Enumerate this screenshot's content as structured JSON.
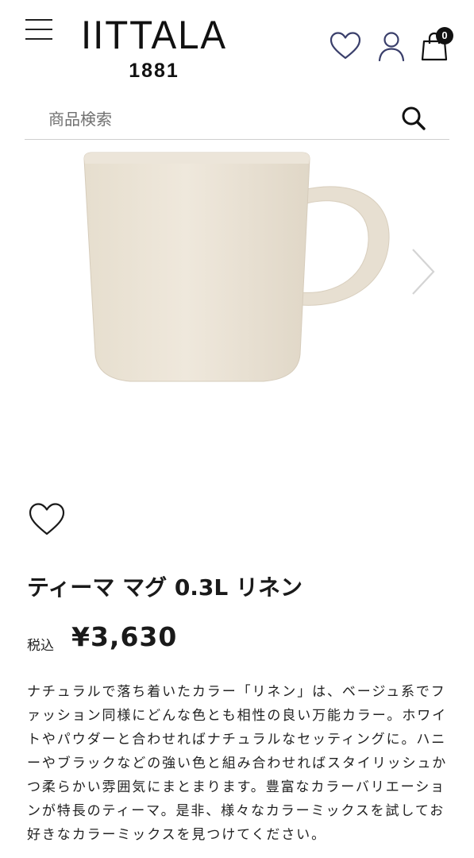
{
  "header": {
    "logo_word": "IITTALA",
    "logo_year": "1881",
    "cart_count": "0"
  },
  "search": {
    "placeholder": "商品検索"
  },
  "product": {
    "title": "ティーマ マグ 0.3L リネン",
    "price_label": "税込",
    "price": "¥3,630",
    "description": "ナチュラルで落ち着いたカラー「リネン」は、ベージュ系でファッション同様にどんな色とも相性の良い万能カラー。ホワイトやパウダーと合わせればナチュラルなセッティングに。ハニーやブラックなどの強い色と組み合わせればスタイリッシュかつ柔らかい雰囲気にまとまります。豊富なカラーバリエーションが特長のティーマ。是非、様々なカラーミックスを試してお好きなカラーミックスを見つけてください。"
  },
  "colors": {
    "mug_body": "#ebe4d8",
    "mug_shadow": "#ddd4c5",
    "text": "#1a1a1a",
    "divider": "#cfcfcf"
  },
  "icons": [
    "menu-icon",
    "heart-icon",
    "user-icon",
    "bag-icon",
    "search-icon",
    "chevron-right-icon"
  ]
}
